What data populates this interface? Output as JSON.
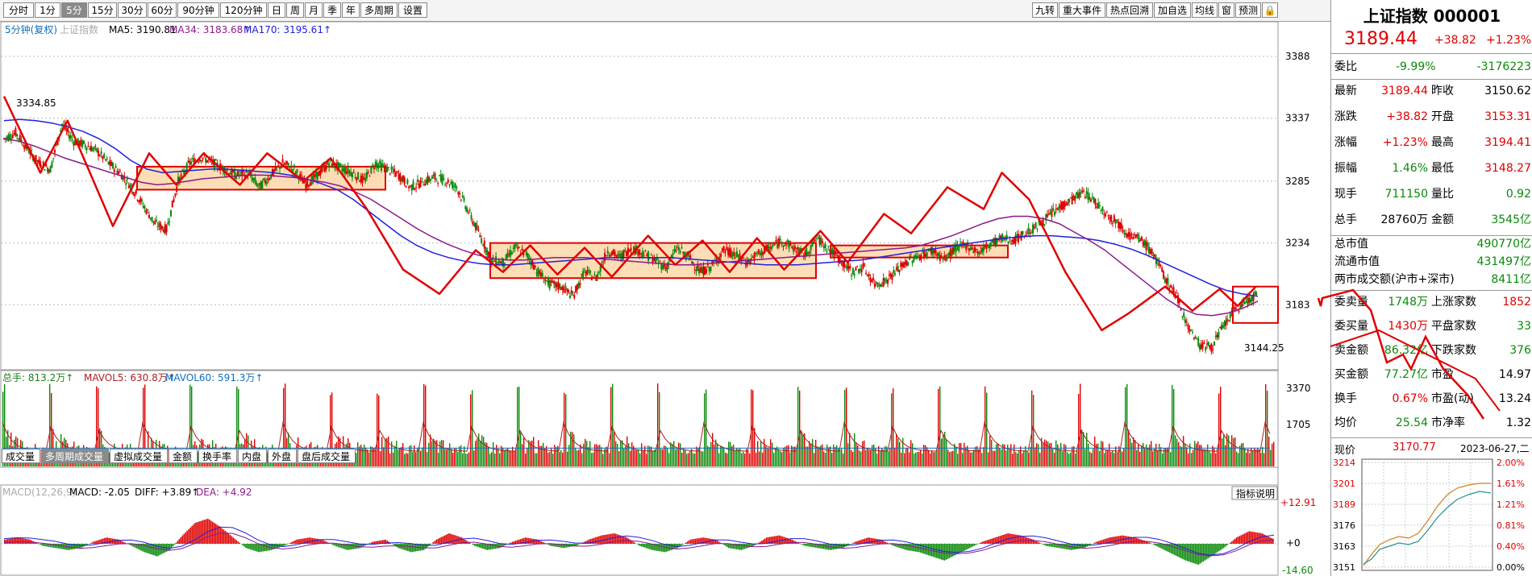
{
  "toolbar": {
    "left_items": [
      "分时",
      "1分",
      "5分",
      "15分",
      "30分",
      "60分",
      "90分钟",
      "120分钟",
      "日",
      "周",
      "月",
      "季",
      "年",
      "多周期",
      "设置"
    ],
    "active_index": 2,
    "right_items": [
      "九转",
      "重大事件",
      "热点回溯",
      "加自选",
      "均线",
      "窗",
      "预测"
    ]
  },
  "main_legend": {
    "period": "5分钟(复权)",
    "index_name": "上证指数",
    "ma5": "MA5: 3190.81",
    "ma34": "MA34: 3183.68↑",
    "ma170": "MA170: 3195.61↑"
  },
  "colors": {
    "up": "#e00000",
    "down": "#0a8a0a",
    "ma5": "#000000",
    "ma34": "#8b1a8b",
    "ma170": "#2020e0",
    "box_fill": "#fbd7a8",
    "box_stroke": "#e00000",
    "zigzag": "#e00000"
  },
  "chart_data": {
    "type": "candlestick",
    "price_axis": {
      "ticks": [
        "3388",
        "3337",
        "3285",
        "3234",
        "3183"
      ],
      "ylim": [
        3130,
        3400
      ]
    },
    "labels": {
      "high_label": "3334.85",
      "low_label": "3144.25"
    },
    "close_path": [
      3320,
      3325,
      3312,
      3300,
      3295,
      3332,
      3318,
      3315,
      3310,
      3300,
      3292,
      3280,
      3265,
      3250,
      3245,
      3285,
      3300,
      3305,
      3300,
      3295,
      3290,
      3292,
      3280,
      3290,
      3300,
      3295,
      3282,
      3290,
      3300,
      3296,
      3292,
      3285,
      3300,
      3295,
      3290,
      3280,
      3284,
      3288,
      3286,
      3280,
      3260,
      3240,
      3220,
      3218,
      3230,
      3225,
      3210,
      3200,
      3198,
      3190,
      3210,
      3205,
      3228,
      3222,
      3230,
      3226,
      3220,
      3214,
      3230,
      3222,
      3210,
      3215,
      3228,
      3224,
      3218,
      3225,
      3230,
      3236,
      3230,
      3224,
      3238,
      3230,
      3220,
      3210,
      3214,
      3200,
      3203,
      3212,
      3220,
      3224,
      3228,
      3220,
      3230,
      3232,
      3226,
      3234,
      3238,
      3236,
      3242,
      3248,
      3256,
      3264,
      3270,
      3276,
      3268,
      3258,
      3250,
      3240,
      3236,
      3225,
      3205,
      3190,
      3165,
      3150,
      3148,
      3165,
      3178,
      3186,
      3192
    ],
    "ma34_path": [
      3320,
      3318,
      3314,
      3309,
      3304,
      3300,
      3296,
      3292,
      3288,
      3284,
      3282,
      3283,
      3285,
      3287,
      3288,
      3289,
      3290,
      3290,
      3289,
      3288,
      3286,
      3284,
      3281,
      3276,
      3270,
      3262,
      3254,
      3246,
      3239,
      3233,
      3228,
      3224,
      3221,
      3220,
      3220,
      3221,
      3222,
      3222,
      3222,
      3221,
      3220,
      3219,
      3218,
      3217,
      3216,
      3216,
      3217,
      3218,
      3219,
      3220,
      3221,
      3222,
      3223,
      3224,
      3225,
      3226,
      3227,
      3228,
      3229,
      3230,
      3232,
      3236,
      3240,
      3245,
      3250,
      3254,
      3256,
      3256,
      3254,
      3250,
      3243,
      3236,
      3228,
      3218,
      3208,
      3198,
      3188,
      3180,
      3175,
      3174,
      3176,
      3180,
      3186
    ],
    "ma170_path": [
      3335,
      3336,
      3335,
      3333,
      3330,
      3326,
      3320,
      3312,
      3302,
      3295,
      3292,
      3293,
      3294,
      3295,
      3295,
      3294,
      3293,
      3292,
      3290,
      3287,
      3283,
      3278,
      3270,
      3260,
      3250,
      3240,
      3232,
      3226,
      3222,
      3219,
      3217,
      3216,
      3216,
      3217,
      3218,
      3219,
      3220,
      3221,
      3222,
      3222,
      3222,
      3222,
      3222,
      3221,
      3220,
      3219,
      3218,
      3217,
      3216,
      3216,
      3216,
      3217,
      3218,
      3219,
      3220,
      3222,
      3224,
      3226,
      3228,
      3230,
      3232,
      3234,
      3236,
      3238,
      3239,
      3240,
      3240,
      3239,
      3238,
      3236,
      3233,
      3229,
      3224,
      3218,
      3212,
      3206,
      3200,
      3195,
      3192,
      3190
    ],
    "zigzag": [
      [
        0,
        3355
      ],
      [
        4,
        3292
      ],
      [
        7,
        3335
      ],
      [
        12,
        3248
      ],
      [
        16,
        3308
      ],
      [
        19,
        3282
      ],
      [
        22,
        3308
      ],
      [
        26,
        3282
      ],
      [
        29,
        3308
      ],
      [
        33,
        3285
      ],
      [
        36,
        3304
      ],
      [
        40,
        3262
      ],
      [
        44,
        3212
      ],
      [
        48,
        3192
      ],
      [
        52,
        3228
      ],
      [
        55,
        3210
      ],
      [
        58,
        3232
      ],
      [
        61,
        3208
      ],
      [
        64,
        3230
      ],
      [
        67,
        3206
      ],
      [
        71,
        3240
      ],
      [
        74,
        3216
      ],
      [
        77,
        3236
      ],
      [
        80,
        3210
      ],
      [
        83,
        3238
      ],
      [
        86,
        3212
      ],
      [
        90,
        3244
      ],
      [
        93,
        3218
      ],
      [
        97,
        3258
      ],
      [
        100,
        3242
      ],
      [
        104,
        3280
      ],
      [
        108,
        3262
      ],
      [
        110,
        3292
      ],
      [
        113,
        3270
      ],
      [
        117,
        3210
      ],
      [
        121,
        3162
      ],
      [
        124,
        3176
      ],
      [
        128,
        3198
      ],
      [
        131,
        3178
      ],
      [
        134,
        3196
      ],
      [
        136,
        3182
      ],
      [
        138,
        3198
      ]
    ],
    "boxes": [
      {
        "label": "box1",
        "top": 3297,
        "bottom": 3278
      },
      {
        "label": "box2",
        "top": 3234,
        "bottom": 3205
      },
      {
        "label": "box3",
        "top": 3232,
        "bottom": 3222
      },
      {
        "label": "box4",
        "top": 3198,
        "bottom": 3168
      }
    ],
    "volume": {
      "legend": {
        "total": "总手: 813.2万↑",
        "mavol5": "MAVOL5: 630.8万↑",
        "mavol60": "MAVOL60: 591.3万↑"
      },
      "ticks": [
        "3370",
        "1705"
      ]
    },
    "macd": {
      "legend": {
        "name": "MACD(12,26,9)",
        "macd": "MACD: -2.05",
        "diff": "DIFF: +3.89↑",
        "dea": "DEA: +4.92"
      },
      "ticks": [
        "+12.91",
        "+0",
        "-14.60"
      ],
      "button": "指标说明",
      "hist": [
        2,
        3,
        2,
        -1,
        -2,
        -3,
        -2,
        1,
        3,
        2,
        -1,
        -4,
        -6,
        -3,
        4,
        10,
        12,
        8,
        3,
        -2,
        -4,
        -3,
        -1,
        2,
        3,
        2,
        -1,
        -3,
        -2,
        1,
        2,
        -2,
        -4,
        -3,
        2,
        5,
        3,
        -1,
        -3,
        -2,
        1,
        3,
        2,
        -1,
        -2,
        -1,
        2,
        4,
        5,
        3,
        -1,
        -3,
        -4,
        -2,
        2,
        3,
        2,
        -2,
        -3,
        -1,
        3,
        4,
        2,
        -1,
        -2,
        -3,
        -2,
        1,
        3,
        2,
        -1,
        -3,
        -4,
        -6,
        -8,
        -5,
        -2,
        1,
        3,
        5,
        4,
        2,
        -1,
        -2,
        -3,
        -2,
        1,
        3,
        4,
        3,
        1,
        -2,
        -5,
        -8,
        -10,
        -6,
        -2,
        3,
        6,
        5,
        2
      ]
    }
  },
  "volume_tabs": [
    "成交量",
    "多周期成交量",
    "虚拟成交量",
    "金额",
    "换手率",
    "内盘",
    "外盘",
    "盘后成交量"
  ],
  "volume_tabs_active": 1,
  "right": {
    "title": "上证指数 000001",
    "price": "3189.44",
    "change": "+38.82",
    "pct": "+1.23%",
    "weibi_label": "委比",
    "weibi_pct": "-9.99%",
    "weibi_val": "-3176223",
    "stats": [
      {
        "l1": "最新",
        "v1": "3189.44",
        "c1": "red",
        "l2": "昨收",
        "v2": "3150.62",
        "c2": "black"
      },
      {
        "l1": "涨跌",
        "v1": "+38.82",
        "c1": "red",
        "l2": "开盘",
        "v2": "3153.31",
        "c2": "red"
      },
      {
        "l1": "涨幅",
        "v1": "+1.23%",
        "c1": "red",
        "l2": "最高",
        "v2": "3194.41",
        "c2": "red"
      },
      {
        "l1": "振幅",
        "v1": "1.46%",
        "c1": "green",
        "l2": "最低",
        "v2": "3148.27",
        "c2": "red"
      },
      {
        "l1": "现手",
        "v1": "711150",
        "c1": "green",
        "l2": "量比",
        "v2": "0.92",
        "c2": "green"
      },
      {
        "l1": "总手",
        "v1": "28760万",
        "c1": "black",
        "l2": "金额",
        "v2": "3545亿",
        "c2": "green"
      }
    ],
    "market": [
      {
        "l": "总市值",
        "v": "490770亿"
      },
      {
        "l": "流通市值",
        "v": "431497亿"
      },
      {
        "l": "两市成交额(沪市+深市)",
        "v": "8411亿"
      }
    ],
    "orders": [
      {
        "l1": "委卖量",
        "v1": "1748万",
        "c1": "green",
        "l2": "上涨家数",
        "v2": "1852",
        "c2": "red"
      },
      {
        "l1": "委买量",
        "v1": "1430万",
        "c1": "red",
        "l2": "平盘家数",
        "v2": "33",
        "c2": "green"
      },
      {
        "l1": "卖金额",
        "v1": "86.32亿",
        "c1": "green",
        "l2": "下跌家数",
        "v2": "376",
        "c2": "green"
      },
      {
        "l1": "买金额",
        "v1": "77.27亿",
        "c1": "green",
        "l2": "市盈",
        "v2": "14.97",
        "c2": "black"
      },
      {
        "l1": "换手",
        "v1": "0.67%",
        "c1": "red",
        "l2": "市盈(动)",
        "v2": "13.24",
        "c2": "black"
      },
      {
        "l1": "均价",
        "v1": "25.54",
        "c1": "green",
        "l2": "市净率",
        "v2": "1.32",
        "c2": "black"
      }
    ],
    "mini": {
      "label": "现价",
      "price": "3170.77",
      "date": "2023-06-27,二",
      "left_ticks": [
        "3214",
        "3201",
        "3189",
        "3176",
        "3163",
        "3151"
      ],
      "right_ticks": [
        "2.00%",
        "1.61%",
        "1.21%",
        "0.81%",
        "0.40%",
        "0.00%"
      ]
    }
  }
}
